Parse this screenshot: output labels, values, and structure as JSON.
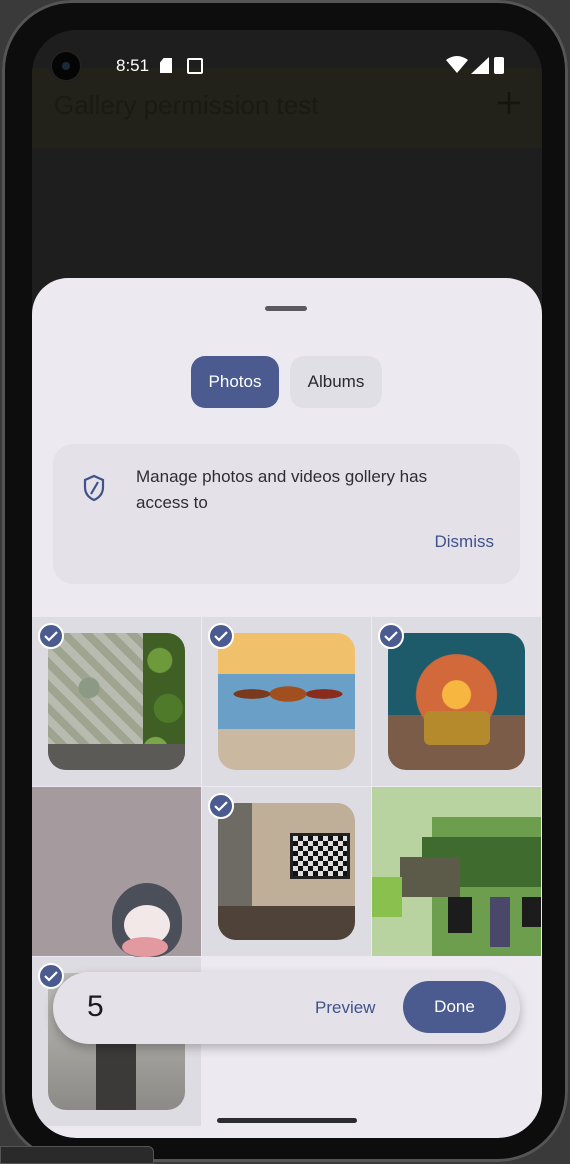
{
  "status": {
    "time": "8:51"
  },
  "app": {
    "title": "Gallery permission test"
  },
  "picker": {
    "tabs": [
      {
        "label": "Photos",
        "selected": true
      },
      {
        "label": "Albums",
        "selected": false
      }
    ],
    "banner": {
      "message": "Manage photos and videos gollery has access to",
      "action": "Dismiss"
    },
    "items": [
      {
        "subject": "patterned wallpaper room",
        "selected": true
      },
      {
        "subject": "running horses",
        "selected": true
      },
      {
        "subject": "ocean wave sofa",
        "selected": true
      },
      {
        "subject": "penguin plush",
        "selected": false
      },
      {
        "subject": "room with tv",
        "selected": true
      },
      {
        "subject": "pixel art house",
        "selected": false
      },
      {
        "subject": "person photo",
        "selected": true
      }
    ],
    "bottom_bar": {
      "selected_count": "5",
      "preview_label": "Preview",
      "done_label": "Done"
    }
  },
  "colors": {
    "accent": "#4b5b8f",
    "sheet": "#eceaf0",
    "link": "#40528a"
  }
}
